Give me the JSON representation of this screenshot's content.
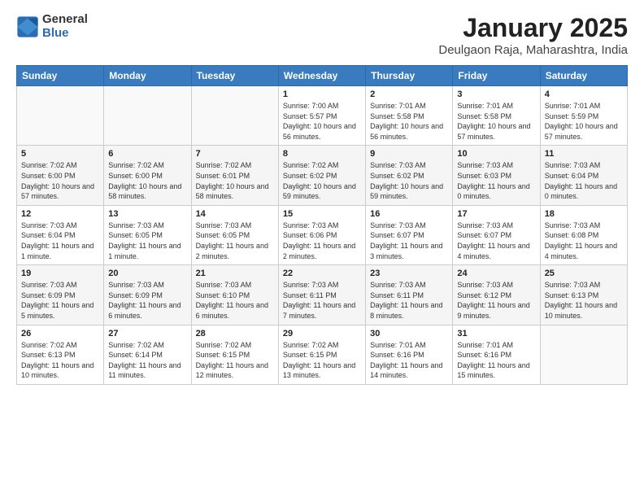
{
  "logo": {
    "general": "General",
    "blue": "Blue"
  },
  "title": "January 2025",
  "subtitle": "Deulgaon Raja, Maharashtra, India",
  "weekdays": [
    "Sunday",
    "Monday",
    "Tuesday",
    "Wednesday",
    "Thursday",
    "Friday",
    "Saturday"
  ],
  "weeks": [
    [
      {
        "day": "",
        "info": ""
      },
      {
        "day": "",
        "info": ""
      },
      {
        "day": "",
        "info": ""
      },
      {
        "day": "1",
        "info": "Sunrise: 7:00 AM\nSunset: 5:57 PM\nDaylight: 10 hours and 56 minutes."
      },
      {
        "day": "2",
        "info": "Sunrise: 7:01 AM\nSunset: 5:58 PM\nDaylight: 10 hours and 56 minutes."
      },
      {
        "day": "3",
        "info": "Sunrise: 7:01 AM\nSunset: 5:58 PM\nDaylight: 10 hours and 57 minutes."
      },
      {
        "day": "4",
        "info": "Sunrise: 7:01 AM\nSunset: 5:59 PM\nDaylight: 10 hours and 57 minutes."
      }
    ],
    [
      {
        "day": "5",
        "info": "Sunrise: 7:02 AM\nSunset: 6:00 PM\nDaylight: 10 hours and 57 minutes."
      },
      {
        "day": "6",
        "info": "Sunrise: 7:02 AM\nSunset: 6:00 PM\nDaylight: 10 hours and 58 minutes."
      },
      {
        "day": "7",
        "info": "Sunrise: 7:02 AM\nSunset: 6:01 PM\nDaylight: 10 hours and 58 minutes."
      },
      {
        "day": "8",
        "info": "Sunrise: 7:02 AM\nSunset: 6:02 PM\nDaylight: 10 hours and 59 minutes."
      },
      {
        "day": "9",
        "info": "Sunrise: 7:03 AM\nSunset: 6:02 PM\nDaylight: 10 hours and 59 minutes."
      },
      {
        "day": "10",
        "info": "Sunrise: 7:03 AM\nSunset: 6:03 PM\nDaylight: 11 hours and 0 minutes."
      },
      {
        "day": "11",
        "info": "Sunrise: 7:03 AM\nSunset: 6:04 PM\nDaylight: 11 hours and 0 minutes."
      }
    ],
    [
      {
        "day": "12",
        "info": "Sunrise: 7:03 AM\nSunset: 6:04 PM\nDaylight: 11 hours and 1 minute."
      },
      {
        "day": "13",
        "info": "Sunrise: 7:03 AM\nSunset: 6:05 PM\nDaylight: 11 hours and 1 minute."
      },
      {
        "day": "14",
        "info": "Sunrise: 7:03 AM\nSunset: 6:05 PM\nDaylight: 11 hours and 2 minutes."
      },
      {
        "day": "15",
        "info": "Sunrise: 7:03 AM\nSunset: 6:06 PM\nDaylight: 11 hours and 2 minutes."
      },
      {
        "day": "16",
        "info": "Sunrise: 7:03 AM\nSunset: 6:07 PM\nDaylight: 11 hours and 3 minutes."
      },
      {
        "day": "17",
        "info": "Sunrise: 7:03 AM\nSunset: 6:07 PM\nDaylight: 11 hours and 4 minutes."
      },
      {
        "day": "18",
        "info": "Sunrise: 7:03 AM\nSunset: 6:08 PM\nDaylight: 11 hours and 4 minutes."
      }
    ],
    [
      {
        "day": "19",
        "info": "Sunrise: 7:03 AM\nSunset: 6:09 PM\nDaylight: 11 hours and 5 minutes."
      },
      {
        "day": "20",
        "info": "Sunrise: 7:03 AM\nSunset: 6:09 PM\nDaylight: 11 hours and 6 minutes."
      },
      {
        "day": "21",
        "info": "Sunrise: 7:03 AM\nSunset: 6:10 PM\nDaylight: 11 hours and 6 minutes."
      },
      {
        "day": "22",
        "info": "Sunrise: 7:03 AM\nSunset: 6:11 PM\nDaylight: 11 hours and 7 minutes."
      },
      {
        "day": "23",
        "info": "Sunrise: 7:03 AM\nSunset: 6:11 PM\nDaylight: 11 hours and 8 minutes."
      },
      {
        "day": "24",
        "info": "Sunrise: 7:03 AM\nSunset: 6:12 PM\nDaylight: 11 hours and 9 minutes."
      },
      {
        "day": "25",
        "info": "Sunrise: 7:03 AM\nSunset: 6:13 PM\nDaylight: 11 hours and 10 minutes."
      }
    ],
    [
      {
        "day": "26",
        "info": "Sunrise: 7:02 AM\nSunset: 6:13 PM\nDaylight: 11 hours and 10 minutes."
      },
      {
        "day": "27",
        "info": "Sunrise: 7:02 AM\nSunset: 6:14 PM\nDaylight: 11 hours and 11 minutes."
      },
      {
        "day": "28",
        "info": "Sunrise: 7:02 AM\nSunset: 6:15 PM\nDaylight: 11 hours and 12 minutes."
      },
      {
        "day": "29",
        "info": "Sunrise: 7:02 AM\nSunset: 6:15 PM\nDaylight: 11 hours and 13 minutes."
      },
      {
        "day": "30",
        "info": "Sunrise: 7:01 AM\nSunset: 6:16 PM\nDaylight: 11 hours and 14 minutes."
      },
      {
        "day": "31",
        "info": "Sunrise: 7:01 AM\nSunset: 6:16 PM\nDaylight: 11 hours and 15 minutes."
      },
      {
        "day": "",
        "info": ""
      }
    ]
  ]
}
